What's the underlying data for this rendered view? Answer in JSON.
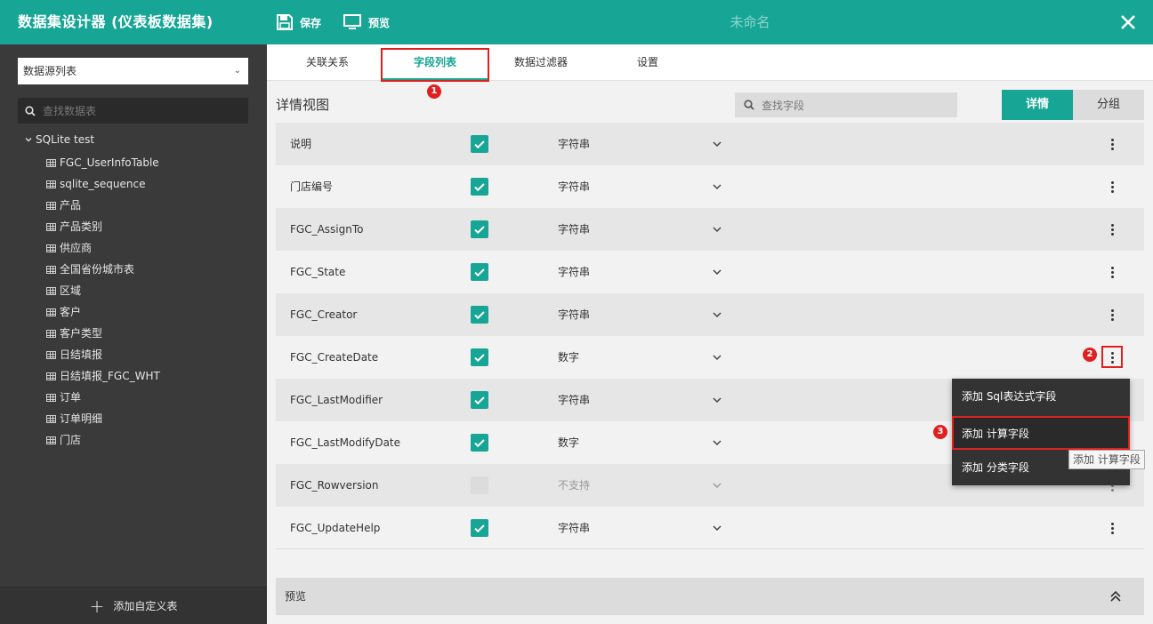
{
  "header": {
    "title": "数据集设计器 (仪表板数据集)",
    "save_label": "保存",
    "preview_label": "预览",
    "document_name": "未命名",
    "colors": {
      "accent": "#17a595",
      "sidebar": "#3a3a3a",
      "annotation": "#e02020"
    }
  },
  "sidebar": {
    "datasource_select": "数据源列表",
    "search_placeholder": "查找数据表",
    "tree_root": "SQLite test",
    "tables": [
      "FGC_UserInfoTable",
      "sqlite_sequence",
      "产品",
      "产品类别",
      "供应商",
      "全国省份城市表",
      "区域",
      "客户",
      "客户类型",
      "日结填报",
      "日结填报_FGC_WHT",
      "订单",
      "订单明细",
      "门店"
    ],
    "footer_label": "添加自定义表"
  },
  "tabs": [
    "关联关系",
    "字段列表",
    "数据过滤器",
    "设置"
  ],
  "active_tab": "字段列表",
  "badges": [
    "1",
    "2",
    "3"
  ],
  "detail": {
    "view_title": "详情视图",
    "search_placeholder": "查找字段",
    "mode_detail": "详情",
    "mode_group": "分组"
  },
  "fields": [
    {
      "name": "说明",
      "checked": true,
      "type": "字符串"
    },
    {
      "name": "门店编号",
      "checked": true,
      "type": "字符串"
    },
    {
      "name": "FGC_AssignTo",
      "checked": true,
      "type": "字符串"
    },
    {
      "name": "FGC_State",
      "checked": true,
      "type": "字符串"
    },
    {
      "name": "FGC_Creator",
      "checked": true,
      "type": "字符串"
    },
    {
      "name": "FGC_CreateDate",
      "checked": true,
      "type": "数字"
    },
    {
      "name": "FGC_LastModifier",
      "checked": true,
      "type": "字符串"
    },
    {
      "name": "FGC_LastModifyDate",
      "checked": true,
      "type": "数字"
    },
    {
      "name": "FGC_Rowversion",
      "checked": false,
      "type": "不支持"
    },
    {
      "name": "FGC_UpdateHelp",
      "checked": true,
      "type": "字符串"
    }
  ],
  "context_menu": {
    "items": [
      "添加 Sql表达式字段",
      "添加 计算字段",
      "添加 分类字段"
    ],
    "tooltip": "添加 计算字段"
  },
  "preview": {
    "label": "预览"
  }
}
